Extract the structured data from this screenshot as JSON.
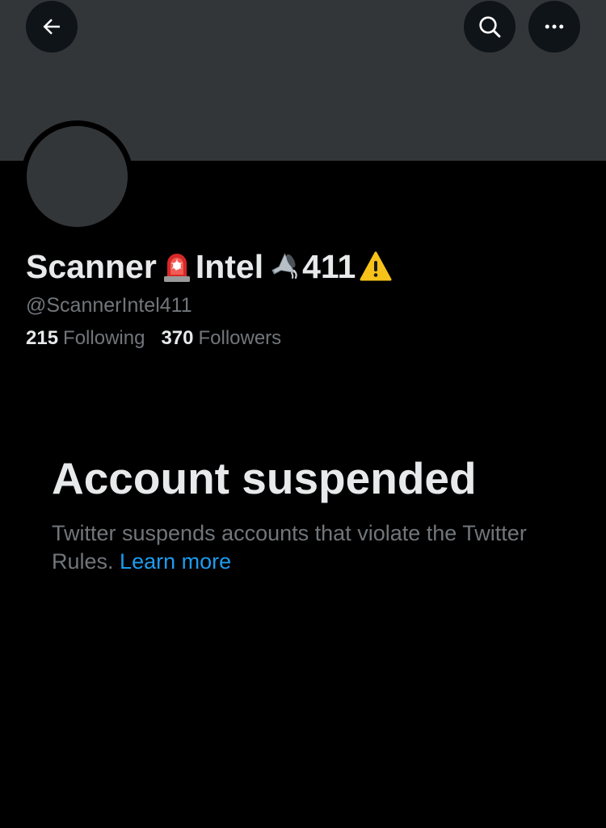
{
  "header": {
    "back_icon": "arrow-left-icon",
    "search_icon": "search-icon",
    "more_icon": "more-horizontal-icon",
    "button_bg": "#0f1419",
    "banner_bg": "#333639"
  },
  "profile": {
    "name_part_1": "Scanner",
    "name_emoji_1": "police-car-light-emoji",
    "name_part_2": "Intel",
    "name_emoji_2": "loudspeaker-emoji",
    "name_part_3": "411",
    "name_emoji_3": "warning-emoji",
    "handle": "@ScannerIntel411",
    "following_count": "215",
    "following_label": "Following",
    "followers_count": "370",
    "followers_label": "Followers"
  },
  "suspension": {
    "title": "Account suspended",
    "message": "Twitter suspends accounts that violate the Twitter Rules. ",
    "link_label": "Learn more",
    "link_color": "#1d9bf0"
  }
}
